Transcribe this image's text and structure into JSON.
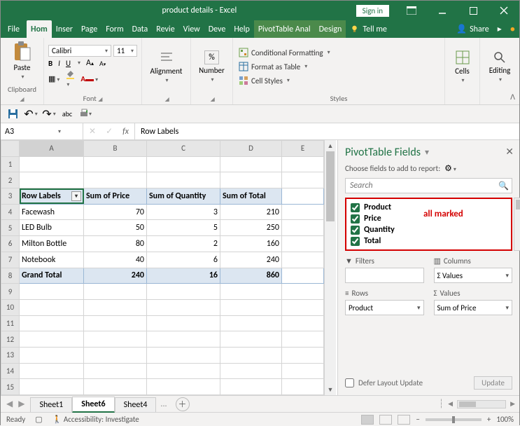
{
  "title": "product details  -  Excel",
  "signin": "Sign in",
  "tabs": {
    "file": "File",
    "list": [
      "Hom",
      "Inser",
      "Page",
      "Form",
      "Data",
      "Revie",
      "View",
      "Deve",
      "Help",
      "PivotTable Anal",
      "Design"
    ],
    "active_index": 0,
    "tellme": "Tell me",
    "share": "Share"
  },
  "ribbon": {
    "clipboard": "Clipboard",
    "paste": "Paste",
    "font_group": "Font",
    "font_name": "Calibri",
    "font_size": "11",
    "alignment": "Alignment",
    "number": "Number",
    "styles_group": "Styles",
    "cond_fmt": "Conditional Formatting",
    "fmt_table": "Format as Table",
    "cell_styles": "Cell Styles",
    "cells": "Cells",
    "editing": "Editing"
  },
  "namebox": "A3",
  "formula_value": "Row Labels",
  "columns": [
    "A",
    "B",
    "C",
    "D",
    "E"
  ],
  "pivot": {
    "header": [
      "Row Labels",
      "Sum of Price",
      "Sum of Quantity",
      "Sum of Total"
    ],
    "rows": [
      {
        "label": "Facewash",
        "price": 70,
        "qty": 3,
        "total": 210
      },
      {
        "label": "LED Bulb",
        "price": 50,
        "qty": 5,
        "total": 250
      },
      {
        "label": "Milton Bottle",
        "price": 80,
        "qty": 2,
        "total": 160
      },
      {
        "label": "Notebook",
        "price": 40,
        "qty": 6,
        "total": 240
      }
    ],
    "grand": {
      "label": "Grand Total",
      "price": 240,
      "qty": 16,
      "total": 860
    }
  },
  "field_pane": {
    "title": "PivotTable Fields",
    "subtitle": "Choose fields to add to report:",
    "search_placeholder": "Search",
    "fields": [
      "Product",
      "Price",
      "Quantity",
      "Total"
    ],
    "annotation": "all marked",
    "filters": "Filters",
    "columns": "Columns",
    "columns_val": "Σ  Values",
    "rows_label": "Rows",
    "rows_val": "Product",
    "values_label": "Values",
    "values_val": "Sum of Price",
    "defer": "Defer Layout Update",
    "update": "Update"
  },
  "sheets": {
    "list": [
      "Sheet1",
      "Sheet6",
      "Sheet4"
    ],
    "active_index": 1,
    "more": "..."
  },
  "status": {
    "ready": "Ready",
    "access": "Accessibility: Investigate",
    "zoom": "100%"
  }
}
